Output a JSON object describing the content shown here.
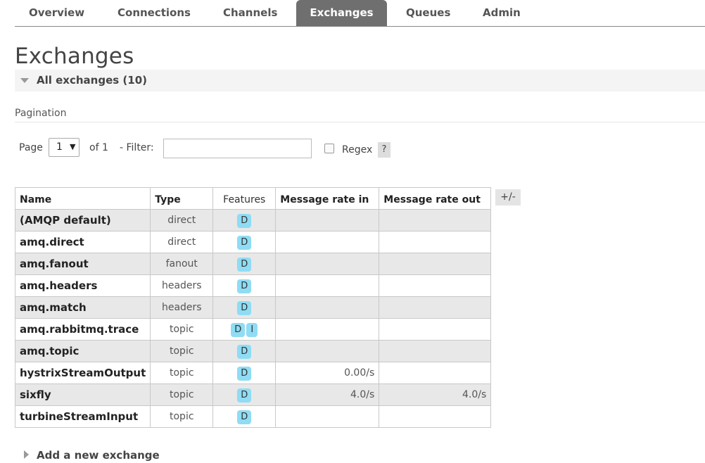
{
  "nav": {
    "tabs": [
      {
        "label": "Overview"
      },
      {
        "label": "Connections"
      },
      {
        "label": "Channels"
      },
      {
        "label": "Exchanges"
      },
      {
        "label": "Queues"
      },
      {
        "label": "Admin"
      }
    ],
    "active_tab": "Exchanges"
  },
  "page": {
    "title": "Exchanges",
    "section_header": "All exchanges (10)"
  },
  "pagination": {
    "label": "Pagination",
    "page_label": "Page",
    "page_value": "1",
    "of_label": "of 1",
    "filter_label": "- Filter:",
    "filter_value": "",
    "regex_label": "Regex",
    "regex_checked": false,
    "help_label": "?"
  },
  "table": {
    "columns": [
      "Name",
      "Type",
      "Features",
      "Message rate in",
      "Message rate out"
    ],
    "toggle_label": "+/-",
    "rows": [
      {
        "name": "(AMQP default)",
        "type": "direct",
        "features": [
          "D"
        ],
        "rate_in": "",
        "rate_out": ""
      },
      {
        "name": "amq.direct",
        "type": "direct",
        "features": [
          "D"
        ],
        "rate_in": "",
        "rate_out": ""
      },
      {
        "name": "amq.fanout",
        "type": "fanout",
        "features": [
          "D"
        ],
        "rate_in": "",
        "rate_out": ""
      },
      {
        "name": "amq.headers",
        "type": "headers",
        "features": [
          "D"
        ],
        "rate_in": "",
        "rate_out": ""
      },
      {
        "name": "amq.match",
        "type": "headers",
        "features": [
          "D"
        ],
        "rate_in": "",
        "rate_out": ""
      },
      {
        "name": "amq.rabbitmq.trace",
        "type": "topic",
        "features": [
          "D",
          "I"
        ],
        "rate_in": "",
        "rate_out": ""
      },
      {
        "name": "amq.topic",
        "type": "topic",
        "features": [
          "D"
        ],
        "rate_in": "",
        "rate_out": ""
      },
      {
        "name": "hystrixStreamOutput",
        "type": "topic",
        "features": [
          "D"
        ],
        "rate_in": "0.00/s",
        "rate_out": ""
      },
      {
        "name": "sixfly",
        "type": "topic",
        "features": [
          "D"
        ],
        "rate_in": "4.0/s",
        "rate_out": "4.0/s"
      },
      {
        "name": "turbineStreamInput",
        "type": "topic",
        "features": [
          "D"
        ],
        "rate_in": "",
        "rate_out": ""
      }
    ]
  },
  "add_section": {
    "label": "Add a new exchange"
  },
  "colors": {
    "active_tab_bg": "#6f6f6f",
    "badge_bg": "#8fdcf4",
    "odd_row_bg": "#e8e8e8"
  }
}
